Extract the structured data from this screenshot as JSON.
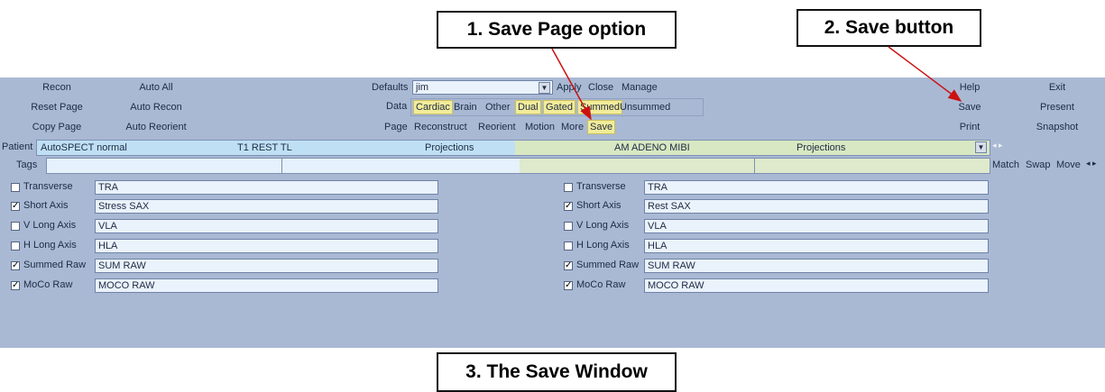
{
  "callouts": {
    "save_page_option": "1. Save Page option",
    "save_button": "2. Save button",
    "save_window": "3. The Save Window"
  },
  "toolbar": {
    "left": {
      "recon": "Recon",
      "auto_all": "Auto All",
      "reset_page": "Reset Page",
      "auto_recon": "Auto Recon",
      "copy_page": "Copy Page",
      "auto_reorient": "Auto Reorient"
    },
    "defaults": {
      "label": "Defaults",
      "value": "jim",
      "apply": "Apply",
      "close": "Close",
      "manage": "Manage"
    },
    "data": {
      "label": "Data",
      "options": [
        "Cardiac",
        "Brain",
        "Other",
        "Dual",
        "Gated",
        "Summed",
        "Unsummed"
      ],
      "highlighted": [
        "Cardiac",
        "Dual",
        "Gated",
        "Summed"
      ]
    },
    "page": {
      "label": "Page",
      "options": [
        "Reconstruct",
        "Reorient",
        "Motion",
        "More",
        "Save"
      ],
      "highlighted": [
        "Save"
      ]
    },
    "right": {
      "help": "Help",
      "exit": "Exit",
      "save": "Save",
      "present": "Present",
      "print": "Print",
      "snapshot": "Snapshot"
    }
  },
  "patient": {
    "label": "Patient",
    "name": "AutoSPECT normal",
    "dataset1": "T1 REST TL",
    "dataset1_type": "Projections",
    "dataset2": "AM ADENO MIBI",
    "dataset2_type": "Projections"
  },
  "tags": {
    "label": "Tags",
    "match": "Match",
    "swap": "Swap",
    "move": "Move"
  },
  "save_left": [
    {
      "label": "Transverse",
      "checked": false,
      "value": "TRA"
    },
    {
      "label": "Short Axis",
      "checked": true,
      "value": "Stress SAX"
    },
    {
      "label": "V Long Axis",
      "checked": false,
      "value": "VLA"
    },
    {
      "label": "H Long Axis",
      "checked": false,
      "value": "HLA"
    },
    {
      "label": "Summed Raw",
      "checked": true,
      "value": "SUM RAW"
    },
    {
      "label": "MoCo Raw",
      "checked": true,
      "value": "MOCO RAW"
    }
  ],
  "save_right": [
    {
      "label": "Transverse",
      "checked": false,
      "value": "TRA"
    },
    {
      "label": "Short Axis",
      "checked": true,
      "value": "Rest SAX"
    },
    {
      "label": "V Long Axis",
      "checked": false,
      "value": "VLA"
    },
    {
      "label": "H Long Axis",
      "checked": false,
      "value": "HLA"
    },
    {
      "label": "Summed Raw",
      "checked": true,
      "value": "SUM RAW"
    },
    {
      "label": "MoCo Raw",
      "checked": true,
      "value": "MOCO RAW"
    }
  ],
  "colors": {
    "panel": "#a9b9d4",
    "highlight": "#f2ec9a",
    "arrow": "#cc1111",
    "patient_bar_left": "#bfe0f4",
    "patient_bar_right": "#d8e8c2"
  },
  "icons": {
    "dropdown": "chevron-down-icon",
    "arrow_left_right": "left-right-arrows-icon"
  }
}
